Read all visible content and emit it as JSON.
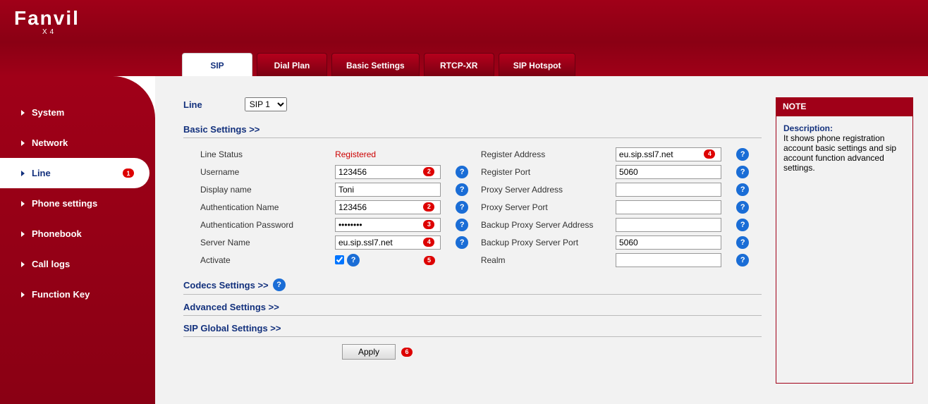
{
  "brand": {
    "name": "Fanvil",
    "model": "X4"
  },
  "tabs": [
    {
      "label": "SIP",
      "active": true
    },
    {
      "label": "Dial Plan"
    },
    {
      "label": "Basic Settings"
    },
    {
      "label": "RTCP-XR"
    },
    {
      "label": "SIP Hotspot"
    }
  ],
  "sidebar": [
    {
      "label": "System"
    },
    {
      "label": "Network"
    },
    {
      "label": "Line",
      "active": true,
      "badge": "1"
    },
    {
      "label": "Phone settings"
    },
    {
      "label": "Phonebook"
    },
    {
      "label": "Call logs"
    },
    {
      "label": "Function Key"
    }
  ],
  "line": {
    "label": "Line",
    "selected": "SIP 1"
  },
  "sections": {
    "basic": "Basic Settings >>",
    "codecs": "Codecs Settings >>",
    "advanced": "Advanced Settings >>",
    "global": "SIP Global Settings >>"
  },
  "form": {
    "left": [
      {
        "label": "Line Status",
        "type": "status",
        "value": "Registered"
      },
      {
        "label": "Username",
        "type": "text",
        "value": "123456",
        "badge": "2"
      },
      {
        "label": "Display name",
        "type": "text",
        "value": "Toni"
      },
      {
        "label": "Authentication Name",
        "type": "text",
        "value": "123456",
        "badge": "2"
      },
      {
        "label": "Authentication Password",
        "type": "password",
        "value": "••••••••",
        "badge": "3"
      },
      {
        "label": "Server Name",
        "type": "text",
        "value": "eu.sip.ssl7.net",
        "badge": "4"
      },
      {
        "label": "Activate",
        "type": "checkbox",
        "checked": true,
        "badge": "5"
      }
    ],
    "right": [
      {
        "label": "Register Address",
        "type": "text",
        "value": "eu.sip.ssl7.net",
        "badge": "4"
      },
      {
        "label": "Register Port",
        "type": "text",
        "value": "5060"
      },
      {
        "label": "Proxy Server Address",
        "type": "text",
        "value": ""
      },
      {
        "label": "Proxy Server Port",
        "type": "text",
        "value": ""
      },
      {
        "label": "Backup Proxy Server Address",
        "type": "text",
        "value": ""
      },
      {
        "label": "Backup Proxy Server Port",
        "type": "text",
        "value": "5060"
      },
      {
        "label": "Realm",
        "type": "text",
        "value": ""
      }
    ]
  },
  "apply": {
    "label": "Apply",
    "badge": "6"
  },
  "note": {
    "title": "NOTE",
    "heading": "Description:",
    "body": "It shows phone registration account basic settings and sip account function advanced settings."
  }
}
